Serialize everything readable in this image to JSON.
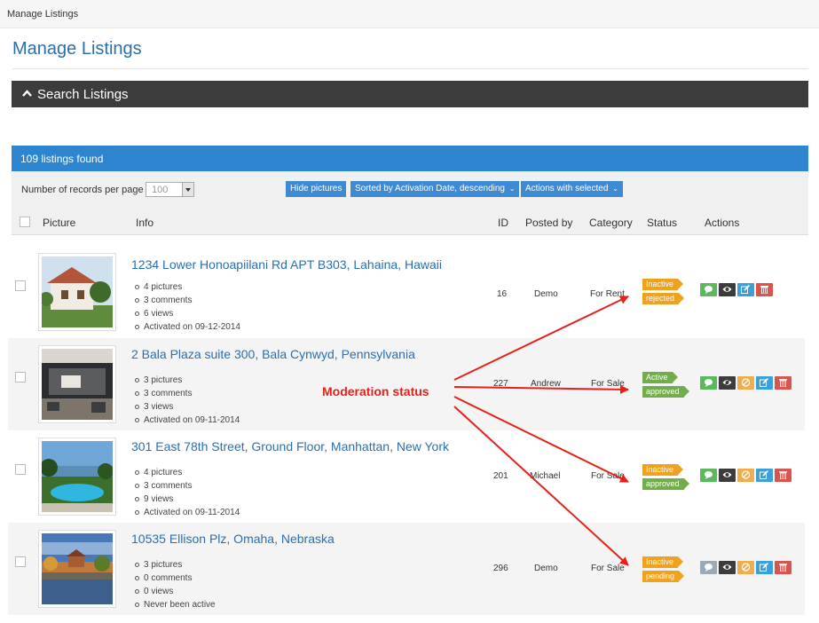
{
  "breadcrumb": "Manage Listings",
  "page_title": "Manage Listings",
  "search_toggle_label": "Search Listings",
  "found_text": "109 listings found",
  "toolbar": {
    "records_label": "Number of records per page",
    "records_value": "100",
    "hide_pictures": "Hide pictures",
    "sort_label": "Sorted by Activation Date, descending",
    "actions_selected": "Actions with selected"
  },
  "columns": {
    "picture": "Picture",
    "info": "Info",
    "id": "ID",
    "posted_by": "Posted by",
    "category": "Category",
    "status": "Status",
    "actions": "Actions"
  },
  "listings": [
    {
      "title": "1234 Lower Honoapiilani Rd APT B303, Lahaina, Hawaii",
      "details": [
        "4 pictures",
        "3 comments",
        "6 views",
        "Activated on 09-12-2014"
      ],
      "id": "16",
      "posted_by": "Demo",
      "category": "For Rent",
      "status": "Inactive",
      "moderation": "rejected",
      "actions": [
        "comment-icon",
        "eye-icon",
        "edit-icon",
        "trash-icon"
      ]
    },
    {
      "title": "2 Bala Plaza suite 300, Bala Cynwyd, Pennsylvania",
      "details": [
        "3 pictures",
        "3 comments",
        "3 views",
        "Activated on 09-11-2014"
      ],
      "id": "227",
      "posted_by": "Andrew",
      "category": "For Sale",
      "status": "Active",
      "moderation": "approved",
      "actions": [
        "comment-icon",
        "eye-off-icon",
        "block-icon",
        "edit-icon",
        "trash-icon"
      ]
    },
    {
      "title": "301 East 78th Street, Ground Floor, Manhattan, New York",
      "details": [
        "4 pictures",
        "3 comments",
        "9 views",
        "Activated on 09-11-2014"
      ],
      "id": "201",
      "posted_by": "Michael",
      "category": "For Sale",
      "status": "Inactive",
      "moderation": "approved",
      "actions": [
        "comment-icon",
        "eye-icon",
        "block-icon",
        "edit-icon",
        "trash-icon"
      ]
    },
    {
      "title": "10535 Ellison Plz, Omaha, Nebraska",
      "details": [
        "3 pictures",
        "0 comments",
        "0 views",
        "Never been active"
      ],
      "id": "296",
      "posted_by": "Demo",
      "category": "For Sale",
      "status": "Inactive",
      "moderation": "pending",
      "actions": [
        "comment-icon",
        "eye-icon",
        "block-icon",
        "edit-icon",
        "trash-icon"
      ]
    }
  ],
  "annotation": "Moderation status",
  "colors": {
    "link": "#2a6fb0",
    "header_bar": "#3c3c3c",
    "found_bar": "#2d85d0",
    "status_inactive": "#f0a11e",
    "status_active": "#72ad4b",
    "moderation_pending": "#f0a11e",
    "moderation_approved": "#72ad4b",
    "btn_comment": "#5cb85c",
    "btn_view": "#3c3c3c",
    "btn_block": "#f0ad4e",
    "btn_edit": "#3b9fd8",
    "btn_delete": "#d9534f",
    "annotation": "#e8201a"
  }
}
